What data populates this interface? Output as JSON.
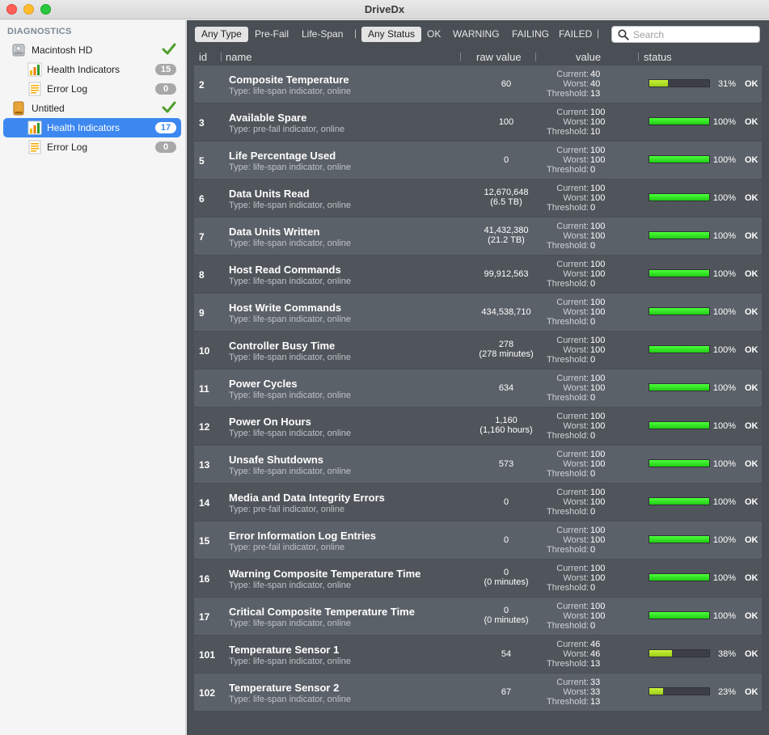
{
  "window": {
    "title": "DriveDx"
  },
  "sidebar": {
    "header": "DIAGNOSTICS",
    "drives": [
      {
        "name": "Macintosh HD",
        "icon": "hard-drive-icon",
        "status": "check-icon",
        "items": [
          {
            "label": "Health Indicators",
            "badge": "15",
            "icon": "bar-chart-icon"
          },
          {
            "label": "Error Log",
            "badge": "0",
            "icon": "document-icon"
          }
        ]
      },
      {
        "name": "Untitled",
        "icon": "external-drive-icon",
        "status": "check-icon",
        "items": [
          {
            "label": "Health Indicators",
            "badge": "17",
            "icon": "bar-chart-icon",
            "selected": true
          },
          {
            "label": "Error Log",
            "badge": "0",
            "icon": "document-icon"
          }
        ]
      }
    ]
  },
  "filters": {
    "type": [
      "Any Type",
      "Pre-Fail",
      "Life-Span"
    ],
    "status": [
      "Any Status",
      "OK",
      "WARNING",
      "FAILING",
      "FAILED"
    ],
    "search_placeholder": "Search"
  },
  "columns": {
    "id": "id",
    "name": "name",
    "raw": "raw value",
    "value": "value",
    "status": "status"
  },
  "value_labels": {
    "current": "Current:",
    "worst": "Worst:",
    "threshold": "Threshold:"
  },
  "colors": {
    "bar_full": "#22d11a",
    "bar_low": "#a8d81e",
    "row_odd": "#5b6168",
    "row_even": "#50555b"
  },
  "rows": [
    {
      "id": "2",
      "name": "Composite Temperature",
      "type": "Type: life-span indicator, online",
      "raw": [
        "60"
      ],
      "current": "40",
      "worst": "40",
      "threshold": "13",
      "pct": 31,
      "pct_label": "31%",
      "status": "OK"
    },
    {
      "id": "3",
      "name": "Available Spare",
      "type": "Type: pre-fail indicator, online",
      "raw": [
        "100"
      ],
      "current": "100",
      "worst": "100",
      "threshold": "10",
      "pct": 100,
      "pct_label": "100%",
      "status": "OK"
    },
    {
      "id": "5",
      "name": "Life Percentage Used",
      "type": "Type: life-span indicator, online",
      "raw": [
        "0"
      ],
      "current": "100",
      "worst": "100",
      "threshold": "0",
      "pct": 100,
      "pct_label": "100%",
      "status": "OK"
    },
    {
      "id": "6",
      "name": "Data Units Read",
      "type": "Type: life-span indicator, online",
      "raw": [
        "12,670,648",
        "(6.5 TB)"
      ],
      "current": "100",
      "worst": "100",
      "threshold": "0",
      "pct": 100,
      "pct_label": "100%",
      "status": "OK"
    },
    {
      "id": "7",
      "name": "Data Units Written",
      "type": "Type: life-span indicator, online",
      "raw": [
        "41,432,380",
        "(21.2 TB)"
      ],
      "current": "100",
      "worst": "100",
      "threshold": "0",
      "pct": 100,
      "pct_label": "100%",
      "status": "OK"
    },
    {
      "id": "8",
      "name": "Host Read Commands",
      "type": "Type: life-span indicator, online",
      "raw": [
        "99,912,563"
      ],
      "current": "100",
      "worst": "100",
      "threshold": "0",
      "pct": 100,
      "pct_label": "100%",
      "status": "OK"
    },
    {
      "id": "9",
      "name": "Host Write Commands",
      "type": "Type: life-span indicator, online",
      "raw": [
        "434,538,710"
      ],
      "current": "100",
      "worst": "100",
      "threshold": "0",
      "pct": 100,
      "pct_label": "100%",
      "status": "OK"
    },
    {
      "id": "10",
      "name": "Controller Busy Time",
      "type": "Type: life-span indicator, online",
      "raw": [
        "278",
        "(278 minutes)"
      ],
      "current": "100",
      "worst": "100",
      "threshold": "0",
      "pct": 100,
      "pct_label": "100%",
      "status": "OK"
    },
    {
      "id": "11",
      "name": "Power Cycles",
      "type": "Type: life-span indicator, online",
      "raw": [
        "634"
      ],
      "current": "100",
      "worst": "100",
      "threshold": "0",
      "pct": 100,
      "pct_label": "100%",
      "status": "OK"
    },
    {
      "id": "12",
      "name": "Power On Hours",
      "type": "Type: life-span indicator, online",
      "raw": [
        "1,160",
        "(1,160 hours)"
      ],
      "current": "100",
      "worst": "100",
      "threshold": "0",
      "pct": 100,
      "pct_label": "100%",
      "status": "OK"
    },
    {
      "id": "13",
      "name": "Unsafe Shutdowns",
      "type": "Type: life-span indicator, online",
      "raw": [
        "573"
      ],
      "current": "100",
      "worst": "100",
      "threshold": "0",
      "pct": 100,
      "pct_label": "100%",
      "status": "OK"
    },
    {
      "id": "14",
      "name": "Media and Data Integrity Errors",
      "type": "Type: pre-fail indicator, online",
      "raw": [
        "0"
      ],
      "current": "100",
      "worst": "100",
      "threshold": "0",
      "pct": 100,
      "pct_label": "100%",
      "status": "OK"
    },
    {
      "id": "15",
      "name": "Error Information Log Entries",
      "type": "Type: pre-fail indicator, online",
      "raw": [
        "0"
      ],
      "current": "100",
      "worst": "100",
      "threshold": "0",
      "pct": 100,
      "pct_label": "100%",
      "status": "OK"
    },
    {
      "id": "16",
      "name": "Warning Composite Temperature Time",
      "type": "Type: life-span indicator, online",
      "raw": [
        "0",
        "(0 minutes)"
      ],
      "current": "100",
      "worst": "100",
      "threshold": "0",
      "pct": 100,
      "pct_label": "100%",
      "status": "OK"
    },
    {
      "id": "17",
      "name": "Critical Composite Temperature Time",
      "type": "Type: life-span indicator, online",
      "raw": [
        "0",
        "(0 minutes)"
      ],
      "current": "100",
      "worst": "100",
      "threshold": "0",
      "pct": 100,
      "pct_label": "100%",
      "status": "OK"
    },
    {
      "id": "101",
      "name": "Temperature Sensor 1",
      "type": "Type: life-span indicator, online",
      "raw": [
        "54"
      ],
      "current": "46",
      "worst": "46",
      "threshold": "13",
      "pct": 38,
      "pct_label": "38%",
      "status": "OK"
    },
    {
      "id": "102",
      "name": "Temperature Sensor 2",
      "type": "Type: life-span indicator, online",
      "raw": [
        "67"
      ],
      "current": "33",
      "worst": "33",
      "threshold": "13",
      "pct": 23,
      "pct_label": "23%",
      "status": "OK"
    }
  ]
}
